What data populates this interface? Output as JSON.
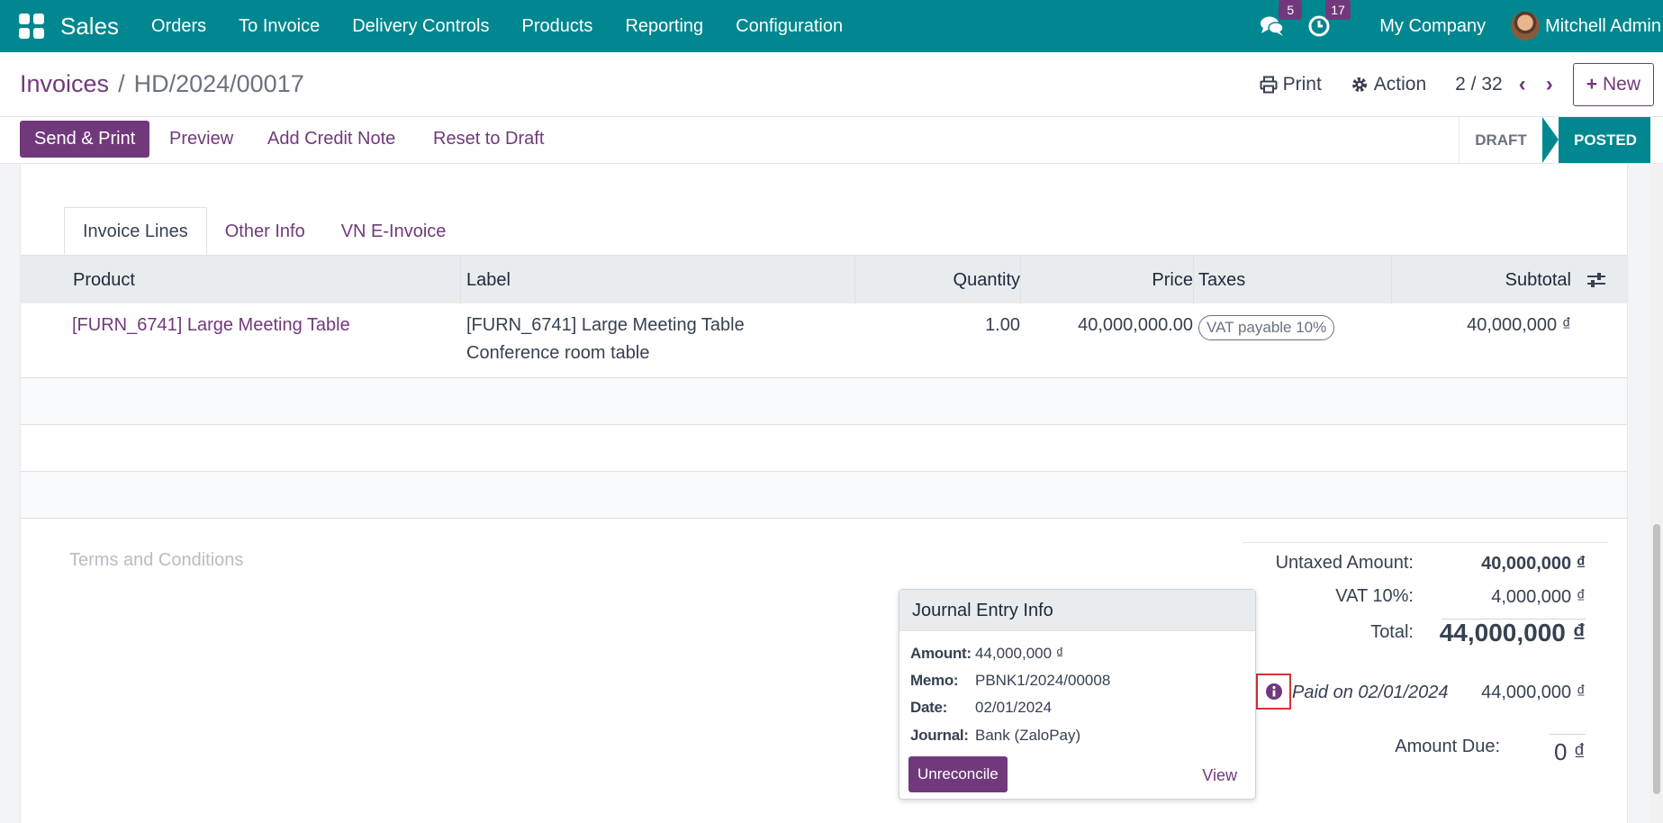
{
  "navbar": {
    "app_name": "Sales",
    "menu": [
      "Orders",
      "To Invoice",
      "Delivery Controls",
      "Products",
      "Reporting",
      "Configuration"
    ],
    "messages_count": "5",
    "activities_count": "17",
    "company": "My Company",
    "user": "Mitchell Admin"
  },
  "control": {
    "breadcrumb_parent": "Invoices",
    "breadcrumb_separator": "/",
    "breadcrumb_current": "HD/2024/00017",
    "print_label": "Print",
    "action_label": "Action",
    "pager": "2 / 32",
    "new_label": "New"
  },
  "statusbar": {
    "send_print": "Send & Print",
    "preview": "Preview",
    "add_credit_note": "Add Credit Note",
    "reset_to_draft": "Reset to Draft",
    "state_draft": "DRAFT",
    "state_posted": "POSTED"
  },
  "tabs": [
    "Invoice Lines",
    "Other Info",
    "VN E-Invoice"
  ],
  "table": {
    "headers": {
      "product": "Product",
      "label": "Label",
      "quantity": "Quantity",
      "price": "Price",
      "taxes": "Taxes",
      "subtotal": "Subtotal"
    },
    "rows": [
      {
        "product": "[FURN_6741] Large Meeting Table",
        "label_line1": "[FURN_6741] Large Meeting Table",
        "label_line2": "Conference room table",
        "quantity": "1.00",
        "price": "40,000,000.00",
        "tax": "VAT payable 10%",
        "subtotal": "40,000,000 ₫"
      }
    ]
  },
  "terms_placeholder": "Terms and Conditions",
  "totals": {
    "untaxed_label": "Untaxed Amount:",
    "untaxed_value": "40,000,000 ₫",
    "vat_label": "VAT 10%:",
    "vat_value": "4,000,000 ₫",
    "total_label": "Total:",
    "total_value": "44,000,000 ₫",
    "paid_text": "Paid on 02/01/2024",
    "paid_value": "44,000,000 ₫",
    "due_label": "Amount Due:",
    "due_value": "0 ₫"
  },
  "popover": {
    "title": "Journal Entry Info",
    "amount_label": "Amount:",
    "amount_value": "44,000,000 ₫",
    "memo_label": "Memo:",
    "memo_value": "PBNK1/2024/00008",
    "date_label": "Date:",
    "date_value": "02/01/2024",
    "journal_label": "Journal:",
    "journal_value": "Bank (ZaloPay)",
    "unreconcile": "Unreconcile",
    "view": "View"
  },
  "colors": {
    "navbar": "#01878f",
    "primary": "#71397c",
    "highlight": "#d43333"
  }
}
